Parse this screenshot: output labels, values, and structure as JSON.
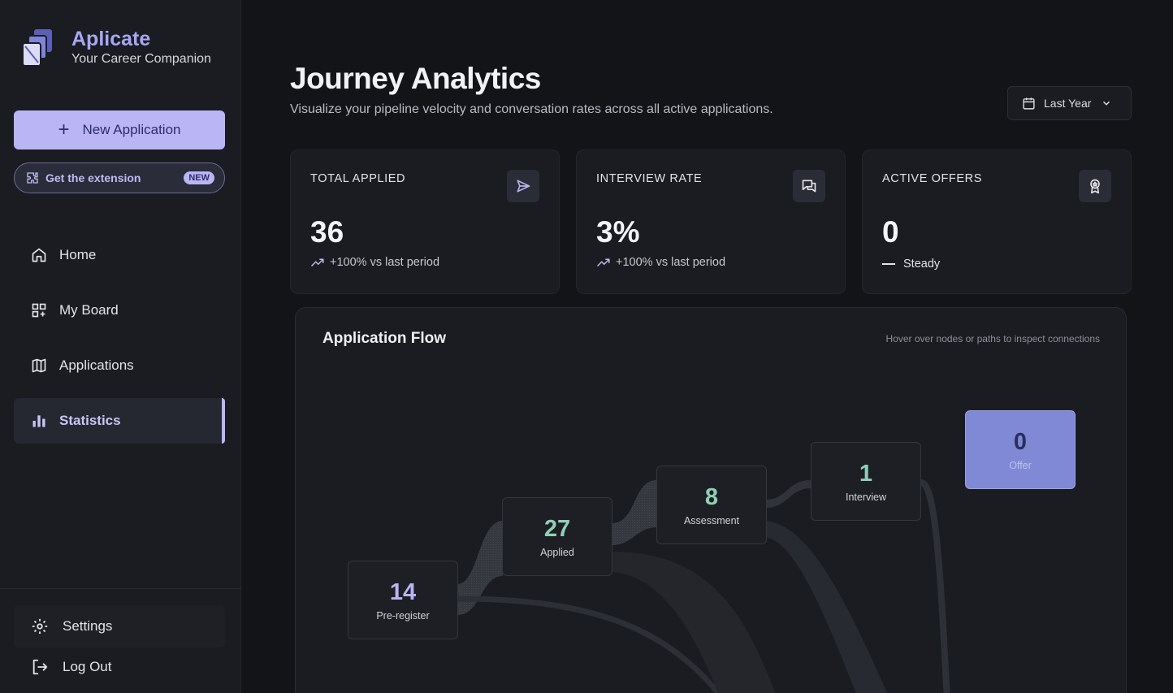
{
  "brand": {
    "name": "Aplicate",
    "tagline": "Your Career Companion"
  },
  "sidebar": {
    "new_application": "New Application",
    "extension": {
      "label": "Get the extension",
      "badge": "NEW"
    },
    "items": [
      {
        "label": "Home",
        "icon": "home-icon"
      },
      {
        "label": "My Board",
        "icon": "board-icon"
      },
      {
        "label": "Applications",
        "icon": "map-icon"
      },
      {
        "label": "Statistics",
        "icon": "bar-chart-icon",
        "active": true
      }
    ],
    "settings": "Settings",
    "logout": "Log Out"
  },
  "header": {
    "title": "Journey Analytics",
    "subtitle": "Visualize your pipeline velocity and conversation rates across all active applications.",
    "range": "Last Year"
  },
  "stats": [
    {
      "label": "TOTAL APPLIED",
      "value": "36",
      "trend": "+100% vs last period",
      "icon": "send-icon"
    },
    {
      "label": "INTERVIEW RATE",
      "value": "3%",
      "trend": "+100% vs last period",
      "icon": "chat-icon"
    },
    {
      "label": "ACTIVE OFFERS",
      "value": "0",
      "trend": "Steady",
      "icon": "award-icon"
    }
  ],
  "flow": {
    "title": "Application Flow",
    "hint": "Hover over nodes or paths to inspect connections",
    "nodes": [
      {
        "value": "14",
        "label": "Pre-register"
      },
      {
        "value": "27",
        "label": "Applied"
      },
      {
        "value": "8",
        "label": "Assessment"
      },
      {
        "value": "1",
        "label": "Interview"
      },
      {
        "value": "0",
        "label": "Offer"
      }
    ]
  },
  "colors": {
    "accent": "#bab6f6",
    "brand": "#a9a6f4",
    "node_number_pre": "#b9b5f3",
    "node_number_stage": "#8fd0b9",
    "offer_node": "#7f89d6"
  }
}
